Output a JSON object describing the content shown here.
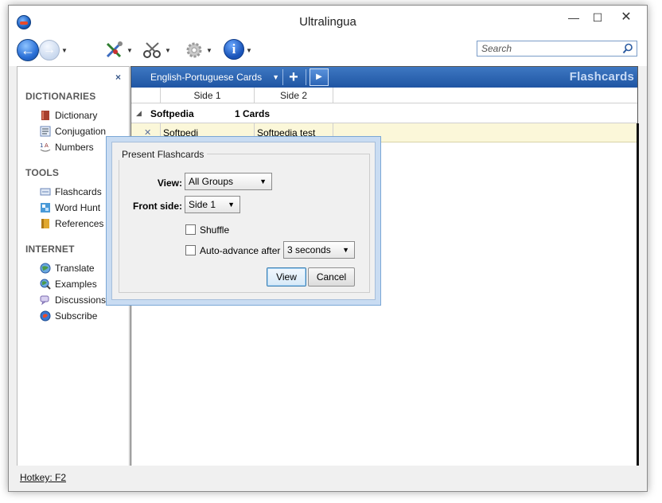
{
  "window": {
    "title": "Ultralingua",
    "min_glyph": "—",
    "max_glyph": "☐",
    "close_glyph": "✕"
  },
  "toolbar": {
    "search_placeholder": "Search"
  },
  "sidebar": {
    "close_glyph": "×",
    "sections": [
      {
        "title": "DICTIONARIES",
        "items": [
          {
            "label": "Dictionary",
            "icon": "book-icon"
          },
          {
            "label": "Conjugation",
            "icon": "conjugation-icon"
          },
          {
            "label": "Numbers",
            "icon": "numbers-icon"
          }
        ]
      },
      {
        "title": "TOOLS",
        "items": [
          {
            "label": "Flashcards",
            "icon": "flashcards-icon"
          },
          {
            "label": "Word Hunt",
            "icon": "word-hunt-icon"
          },
          {
            "label": "References",
            "icon": "references-icon"
          }
        ]
      },
      {
        "title": "INTERNET",
        "items": [
          {
            "label": "Translate",
            "icon": "globe-icon"
          },
          {
            "label": "Examples",
            "icon": "globe-search-icon"
          },
          {
            "label": "Discussions",
            "icon": "discussion-icon"
          },
          {
            "label": "Subscribe",
            "icon": "subscribe-icon"
          }
        ]
      }
    ]
  },
  "flashcards": {
    "deck_name": "English-Portuguese Cards",
    "add_glyph": "+",
    "panel_title": "Flashcards",
    "columns": [
      "Side 1",
      "Side 2"
    ],
    "group": {
      "name": "Softpedia",
      "count": "1 Cards"
    },
    "cards": [
      {
        "side1": "Softpedi",
        "side2": "Softpedia test"
      }
    ]
  },
  "dialog": {
    "title": "Present Flashcards",
    "view_label": "View:",
    "view_value": "All Groups",
    "front_side_label": "Front side:",
    "front_side_value": "Side 1",
    "shuffle_label": "Shuffle",
    "shuffle_checked": false,
    "auto_advance_label": "Auto-advance after",
    "auto_advance_checked": false,
    "auto_advance_value": "3 seconds",
    "view_button": "View",
    "cancel_button": "Cancel"
  },
  "status": {
    "hotkey": "Hotkey: F2"
  },
  "colors": {
    "deck_bar": "#2a62b0",
    "card_row": "#fbf7d9",
    "sidebar_heading": "#595959"
  }
}
